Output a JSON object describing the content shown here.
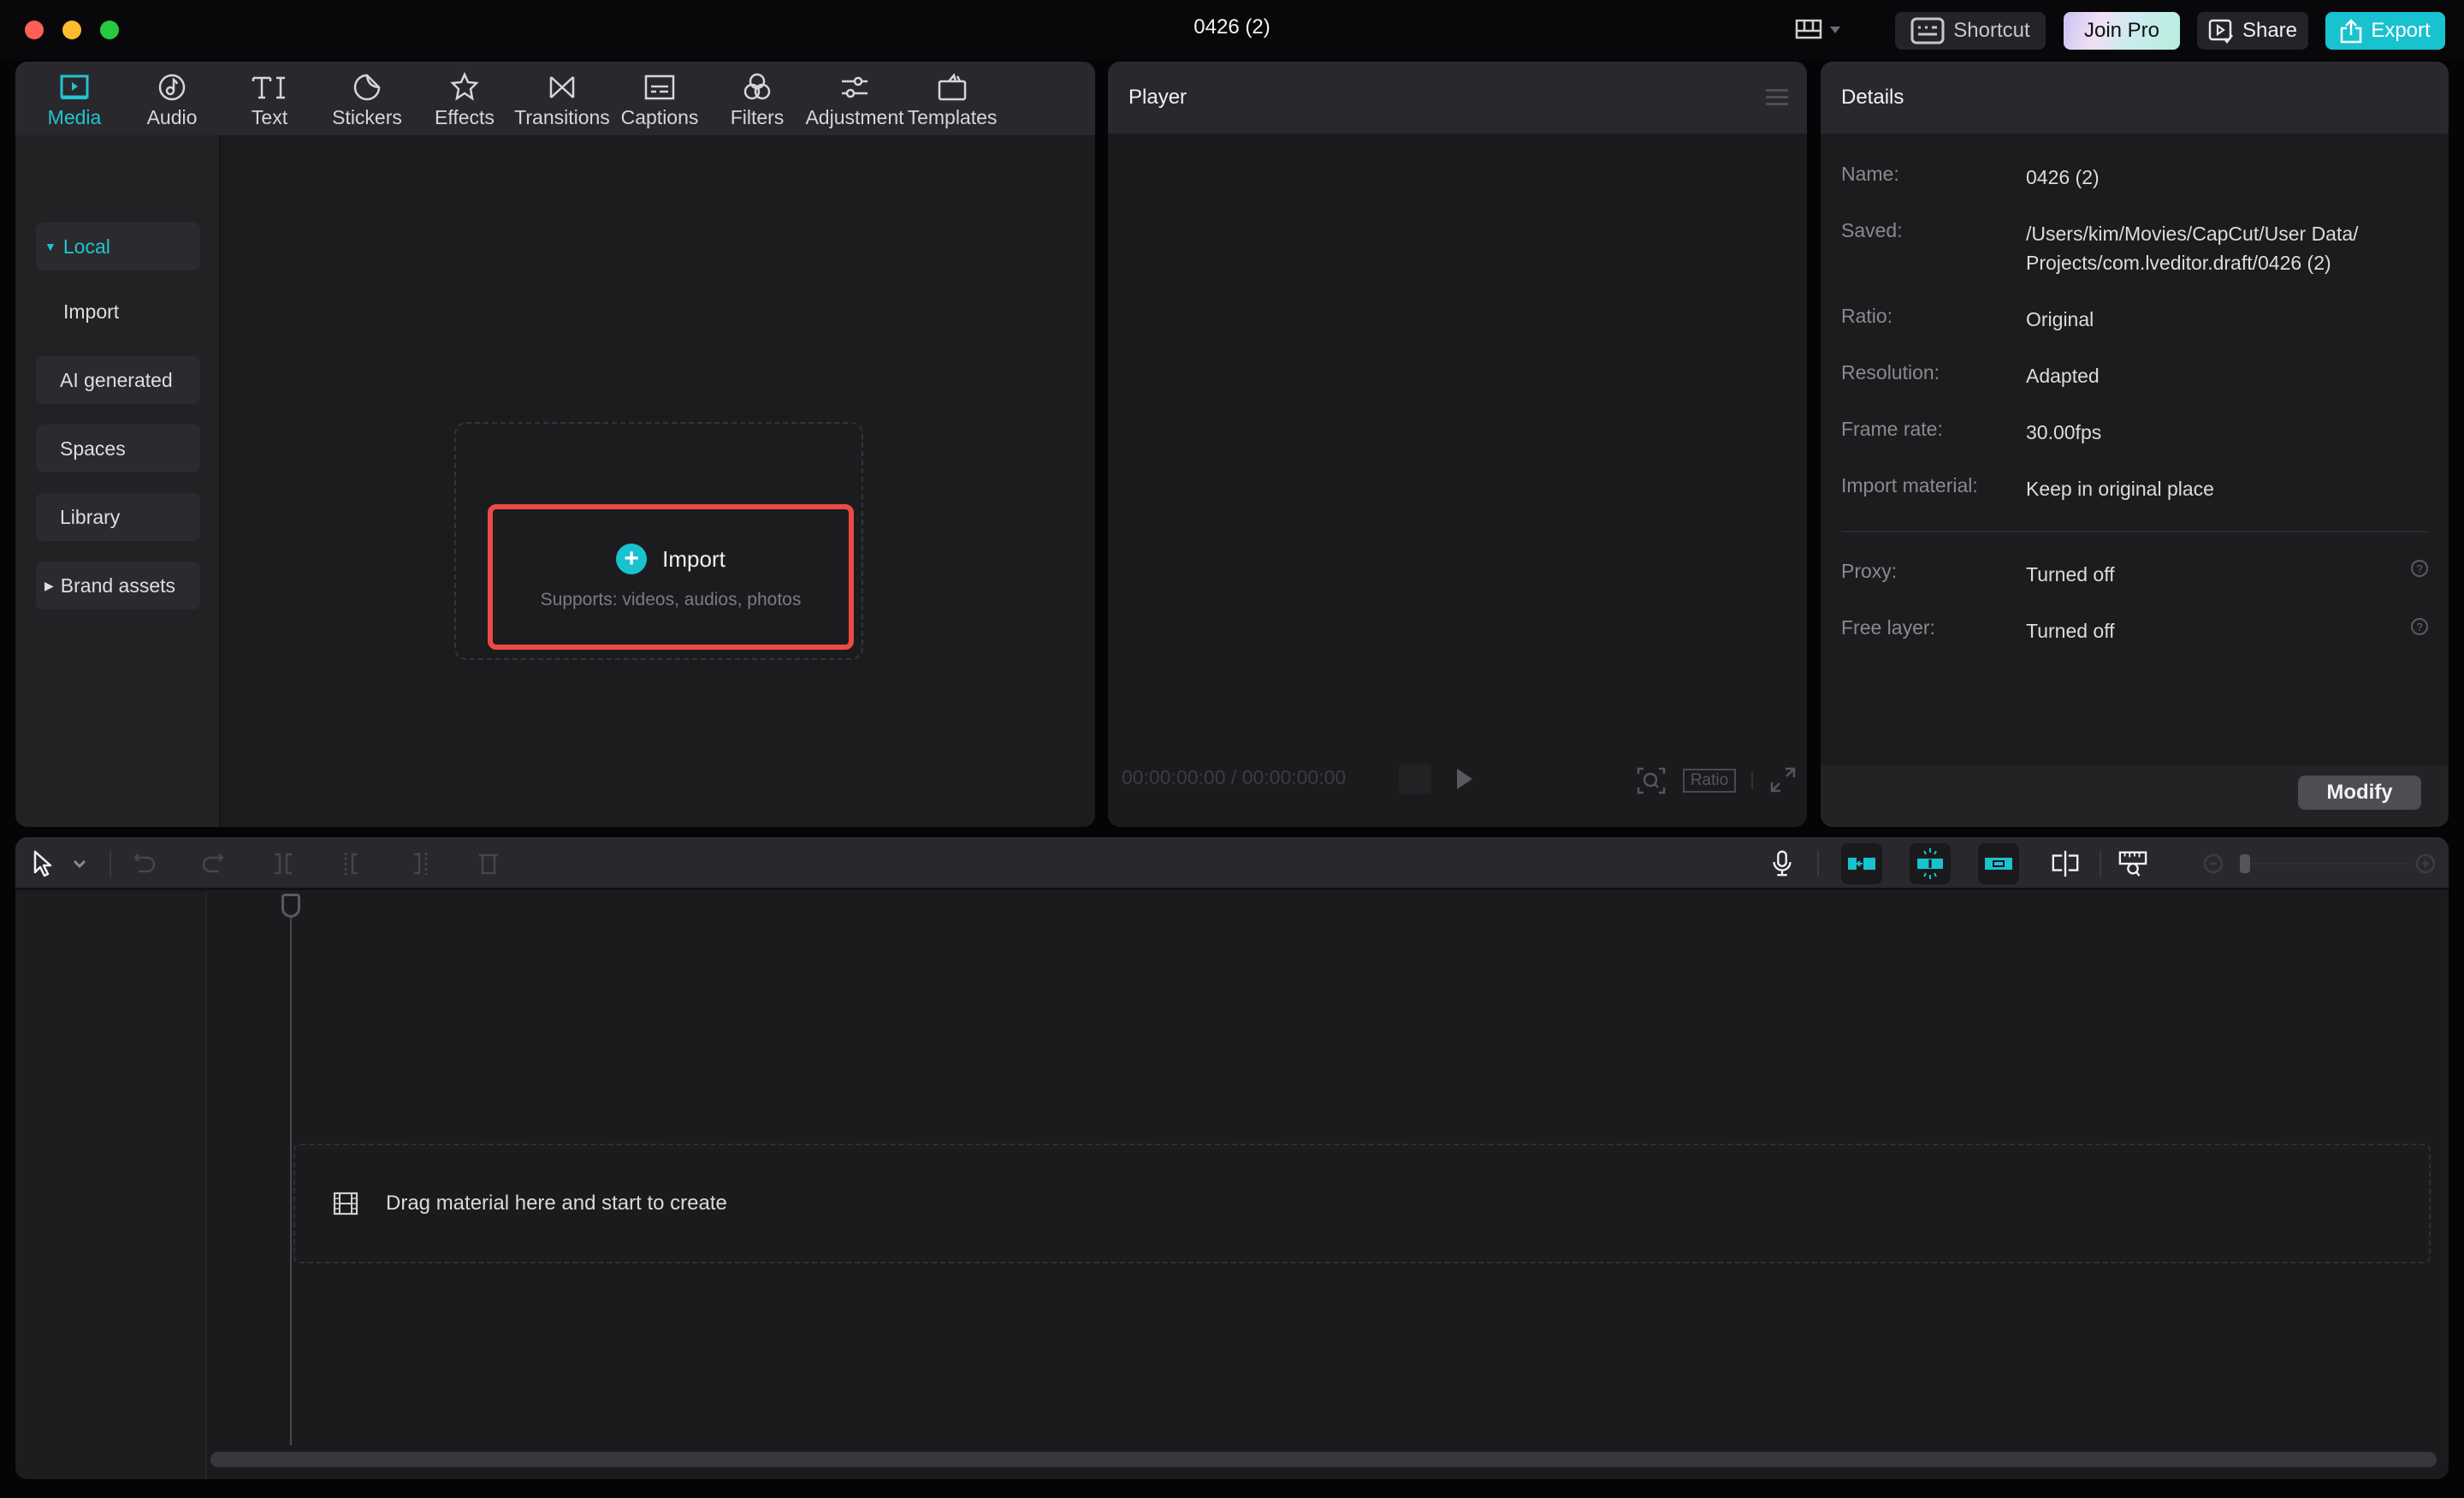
{
  "window": {
    "title": "0426 (2)",
    "traffic_lights": [
      "close",
      "minimize",
      "maximize"
    ]
  },
  "toolbar": {
    "layout_icon": "layout-grid-icon",
    "shortcut_label": "Shortcut",
    "join_pro_label": "Join Pro",
    "share_label": "Share",
    "export_label": "Export",
    "accent_color": "#19c2cf"
  },
  "media_tabs": [
    {
      "label": "Media",
      "icon": "media-icon",
      "active": true
    },
    {
      "label": "Audio",
      "icon": "audio-icon"
    },
    {
      "label": "Text",
      "icon": "text-icon"
    },
    {
      "label": "Stickers",
      "icon": "stickers-icon"
    },
    {
      "label": "Effects",
      "icon": "effects-icon"
    },
    {
      "label": "Transitions",
      "icon": "transitions-icon"
    },
    {
      "label": "Captions",
      "icon": "captions-icon"
    },
    {
      "label": "Filters",
      "icon": "filters-icon"
    },
    {
      "label": "Adjustment",
      "icon": "adjustment-icon"
    },
    {
      "label": "Templates",
      "icon": "templates-icon"
    }
  ],
  "media_sidebar": [
    {
      "label": "Local",
      "expanded": true,
      "active": true
    },
    {
      "label": "Import"
    },
    {
      "label": "AI generated"
    },
    {
      "label": "Spaces"
    },
    {
      "label": "Library"
    },
    {
      "label": "Brand assets",
      "expanded": false
    }
  ],
  "import_box": {
    "title": "Import",
    "subtitle": "Supports: videos, audios, photos"
  },
  "player": {
    "title": "Player",
    "current_time": "00:00:00:00",
    "separator": "/",
    "total_time": "00:00:00:00",
    "ratio_label": "Ratio"
  },
  "details": {
    "title": "Details",
    "rows": [
      {
        "label": "Name:",
        "value": "0426 (2)"
      },
      {
        "label": "Saved:",
        "value": "/Users/kim/Movies/CapCut/User Data/ Projects/com.lveditor.draft/0426 (2)"
      },
      {
        "label": "Ratio:",
        "value": "Original"
      },
      {
        "label": "Resolution:",
        "value": "Adapted"
      },
      {
        "label": "Frame rate:",
        "value": "30.00fps"
      },
      {
        "label": "Import material:",
        "value": "Keep in original place"
      },
      {
        "label": "Proxy:",
        "value": "Turned off",
        "help": true
      },
      {
        "label": "Free layer:",
        "value": "Turned off",
        "help": true
      }
    ],
    "modify_label": "Modify"
  },
  "timeline": {
    "drop_hint": "Drag material here and start to create",
    "tools": [
      "select-icon",
      "undo-icon",
      "redo-icon",
      "split-icon",
      "split-left-icon",
      "split-right-icon",
      "delete-icon"
    ],
    "right_tools": [
      "microphone-icon",
      "main-track-magnet-icon",
      "auto-snap-icon",
      "linkage-icon",
      "preview-axis-icon",
      "zoom-to-fit-icon",
      "zoom-out-icon",
      "zoom-in-icon"
    ]
  }
}
